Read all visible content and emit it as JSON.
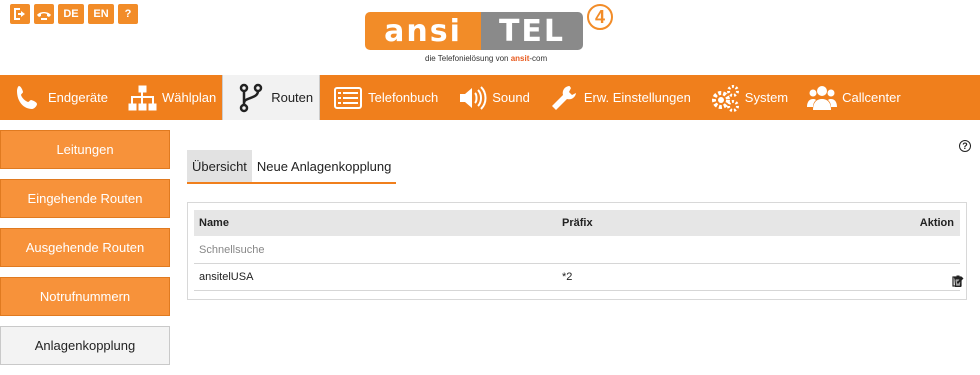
{
  "top_icons": {
    "exit_icon": "exit-icon",
    "phone_icon": "phone-hangup-icon",
    "lang_de": "DE",
    "lang_en": "EN",
    "help": "?"
  },
  "logo": {
    "part1": "ansi",
    "part2": "TEL",
    "version": "4",
    "tagline_prefix": "die Telefonielösung von",
    "tagline_brand": "ansit",
    "tagline_suffix": "-com"
  },
  "nav": {
    "items": [
      {
        "label": "Endgeräte",
        "icon": "phone-icon"
      },
      {
        "label": "Wählplan",
        "icon": "sitemap-icon"
      },
      {
        "label": "Routen",
        "icon": "route-icon",
        "active": true
      },
      {
        "label": "Telefonbuch",
        "icon": "phonebook-icon"
      },
      {
        "label": "Sound",
        "icon": "speaker-icon"
      },
      {
        "label": "Erw. Einstellungen",
        "icon": "wrench-icon"
      },
      {
        "label": "System",
        "icon": "gears-icon"
      },
      {
        "label": "Callcenter",
        "icon": "users-icon"
      }
    ]
  },
  "sidebar": {
    "items": [
      {
        "label": "Leitungen"
      },
      {
        "label": "Eingehende Routen"
      },
      {
        "label": "Ausgehende Routen"
      },
      {
        "label": "Notrufnummern"
      },
      {
        "label": "Anlagenkopplung",
        "active": true
      }
    ]
  },
  "tabs": [
    {
      "label": "Übersicht",
      "active": true
    },
    {
      "label": "Neue Anlagenkopplung"
    }
  ],
  "help_label": "?",
  "table": {
    "columns": [
      "Name",
      "Präfix",
      "Aktion"
    ],
    "search_placeholder": "Schnellsuche",
    "rows": [
      {
        "name": "ansitelUSA",
        "prefix": "*2"
      }
    ]
  },
  "colors": {
    "accent": "#f07f1c",
    "sidebar_button": "#f7923a",
    "logo_gray": "#8a8a8a"
  }
}
